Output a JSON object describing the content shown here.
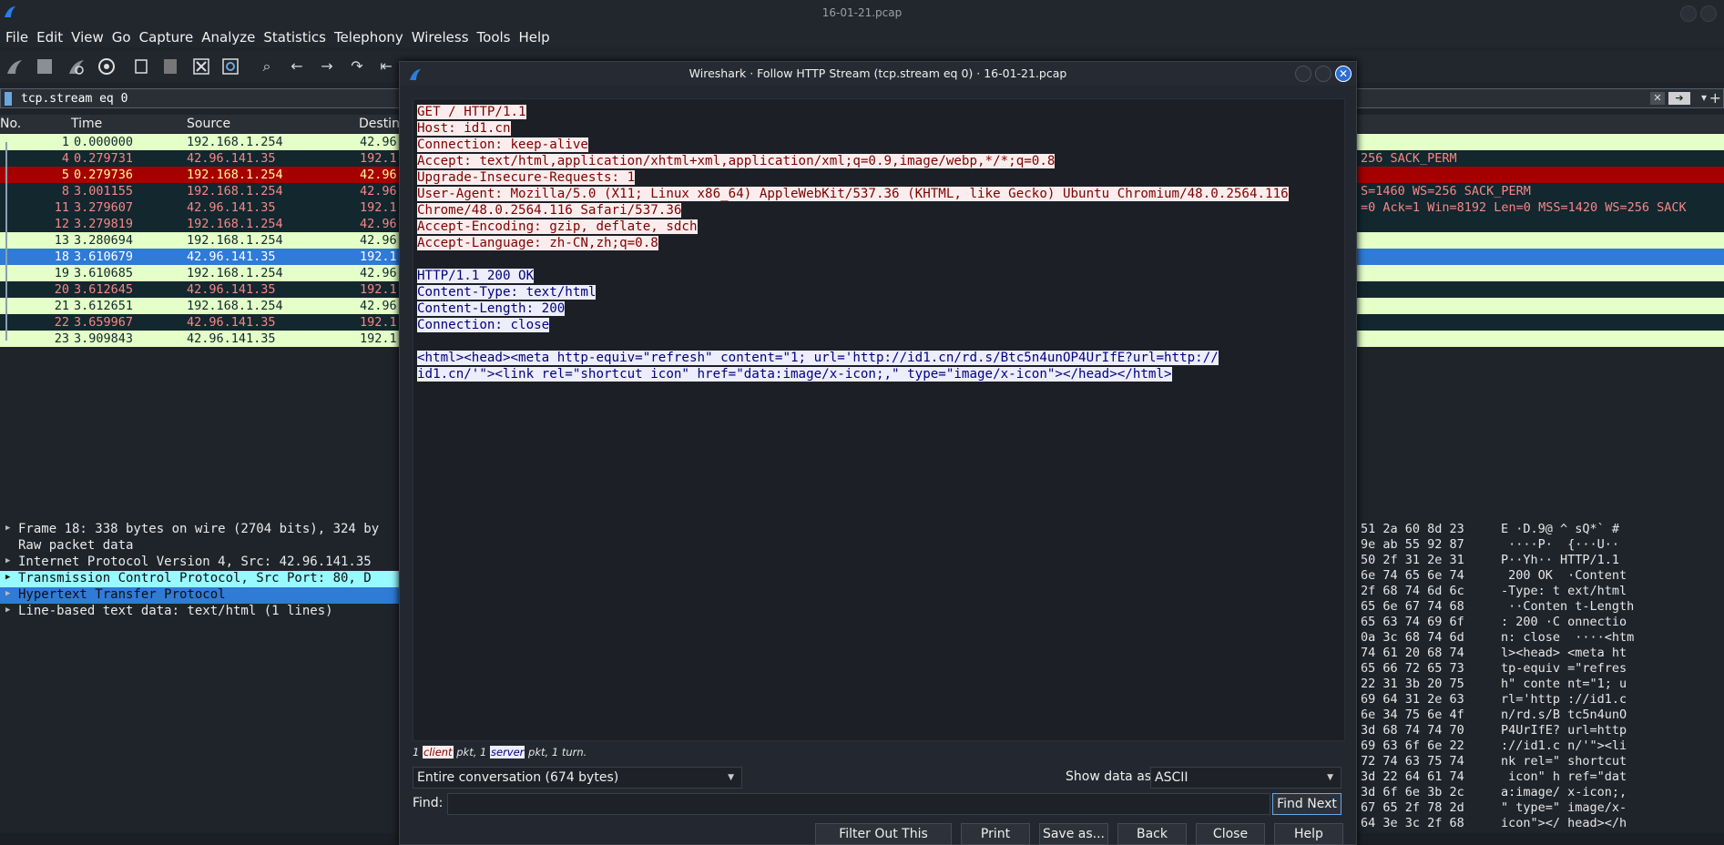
{
  "window": {
    "title": "16-01-21.pcap"
  },
  "menubar": [
    "File",
    "Edit",
    "View",
    "Go",
    "Capture",
    "Analyze",
    "Statistics",
    "Telephony",
    "Wireless",
    "Tools",
    "Help"
  ],
  "filter": {
    "value": "tcp.stream eq 0"
  },
  "packet_list": {
    "columns": {
      "no": "No.",
      "time": "Time",
      "source": "Source",
      "dest": "Destin"
    },
    "rows": [
      {
        "no": "1",
        "time": "0.000000",
        "src": "192.168.1.254",
        "dst": "42.96",
        "info": "",
        "style": "light"
      },
      {
        "no": "4",
        "time": "0.279731",
        "src": "42.96.141.35",
        "dst": "192.1",
        "info": "256 SACK_PERM",
        "style": "dark"
      },
      {
        "no": "5",
        "time": "0.279736",
        "src": "192.168.1.254",
        "dst": "42.96",
        "info": "",
        "style": "rst"
      },
      {
        "no": "8",
        "time": "3.001155",
        "src": "192.168.1.254",
        "dst": "42.96",
        "info": "S=1460 WS=256 SACK_PERM",
        "style": "dark"
      },
      {
        "no": "11",
        "time": "3.279607",
        "src": "42.96.141.35",
        "dst": "192.1",
        "info": "=0 Ack=1 Win=8192 Len=0 MSS=1420 WS=256 SACK",
        "style": "dark"
      },
      {
        "no": "12",
        "time": "3.279819",
        "src": "192.168.1.254",
        "dst": "42.96",
        "info": "",
        "style": "dark"
      },
      {
        "no": "13",
        "time": "3.280694",
        "src": "192.168.1.254",
        "dst": "42.96",
        "info": "",
        "style": "light"
      },
      {
        "no": "18",
        "time": "3.610679",
        "src": "42.96.141.35",
        "dst": "192.1",
        "info": "",
        "style": "sel"
      },
      {
        "no": "19",
        "time": "3.610685",
        "src": "192.168.1.254",
        "dst": "42.96",
        "info": "",
        "style": "light"
      },
      {
        "no": "20",
        "time": "3.612645",
        "src": "42.96.141.35",
        "dst": "192.1",
        "info": "",
        "style": "dark"
      },
      {
        "no": "21",
        "time": "3.612651",
        "src": "192.168.1.254",
        "dst": "42.96",
        "info": "",
        "style": "light"
      },
      {
        "no": "22",
        "time": "3.659967",
        "src": "42.96.141.35",
        "dst": "192.1",
        "info": "",
        "style": "dark"
      },
      {
        "no": "23",
        "time": "3.909843",
        "src": "42.96.141.35",
        "dst": "192.1",
        "info": "",
        "style": "light"
      }
    ]
  },
  "details": [
    {
      "text": "Frame 18: 338 bytes on wire (2704 bits), 324 by",
      "arrow": true,
      "style": ""
    },
    {
      "text": "Raw packet data",
      "arrow": false,
      "style": ""
    },
    {
      "text": "Internet Protocol Version 4, Src: 42.96.141.35",
      "arrow": true,
      "style": ""
    },
    {
      "text": "Transmission Control Protocol, Src Port: 80, D",
      "arrow": true,
      "style": "hl"
    },
    {
      "text": "Hypertext Transfer Protocol",
      "arrow": true,
      "style": "sel"
    },
    {
      "text": "Line-based text data: text/html (1 lines)",
      "arrow": true,
      "style": ""
    }
  ],
  "bytes": [
    {
      "hex": "51 2a 60 8d 23",
      "ascii": "E ·D.9@ ^ sQ*` #"
    },
    {
      "hex": "9e ab 55 92 87",
      "ascii": " ····P·  {···U··"
    },
    {
      "hex": "50 2f 31 2e 31",
      "ascii": "P··Yh·· HTTP/1.1"
    },
    {
      "hex": "6e 74 65 6e 74",
      "ascii": " 200 OK  ·Content"
    },
    {
      "hex": "2f 68 74 6d 6c",
      "ascii": "-Type: t ext/html"
    },
    {
      "hex": "65 6e 67 74 68",
      "ascii": " ··Conten t-Length"
    },
    {
      "hex": "65 63 74 69 6f",
      "ascii": ": 200 ·C onnectio"
    },
    {
      "hex": "0a 3c 68 74 6d",
      "ascii": "n: close  ····<htm"
    },
    {
      "hex": "74 61 20 68 74",
      "ascii": "l><head> <meta ht"
    },
    {
      "hex": "65 66 72 65 73",
      "ascii": "tp-equiv =\"refres"
    },
    {
      "hex": "22 31 3b 20 75",
      "ascii": "h\" conte nt=\"1; u"
    },
    {
      "hex": "69 64 31 2e 63",
      "ascii": "rl='http ://id1.c"
    },
    {
      "hex": "6e 34 75 6e 4f",
      "ascii": "n/rd.s/B tc5n4unO"
    },
    {
      "hex": "3d 68 74 74 70",
      "ascii": "P4UrIfE? url=http"
    },
    {
      "hex": "69 63 6f 6e 22",
      "ascii": "://id1.c n/'\"><li"
    },
    {
      "hex": "72 74 63 75 74",
      "ascii": "nk rel=\" shortcut"
    },
    {
      "hex": "3d 22 64 61 74",
      "ascii": " icon\" h ref=\"dat"
    },
    {
      "hex": "3d 6f 6e 3b 2c",
      "ascii": "a:image/ x-icon;,"
    },
    {
      "hex": "67 65 2f 78 2d",
      "ascii": "\" type=\" image/x-"
    },
    {
      "hex": "64 3e 3c 2f 68",
      "ascii": "icon\"></ head></h"
    }
  ],
  "dialog": {
    "title": "Wireshark · Follow HTTP Stream (tcp.stream eq 0) · 16-01-21.pcap",
    "stream_lines": [
      {
        "text": "GET / HTTP/1.1",
        "dir": "c"
      },
      {
        "text": "Host: id1.cn",
        "dir": "c"
      },
      {
        "text": "Connection: keep-alive",
        "dir": "c"
      },
      {
        "text": "Accept: text/html,application/xhtml+xml,application/xml;q=0.9,image/webp,*/*;q=0.8",
        "dir": "c"
      },
      {
        "text": "Upgrade-Insecure-Requests: 1",
        "dir": "c"
      },
      {
        "text": "User-Agent: Mozilla/5.0 (X11; Linux x86_64) AppleWebKit/537.36 (KHTML, like Gecko) Ubuntu Chromium/48.0.2564.116",
        "dir": "c"
      },
      {
        "text": "Chrome/48.0.2564.116 Safari/537.36",
        "dir": "c"
      },
      {
        "text": "Accept-Encoding: gzip, deflate, sdch",
        "dir": "c"
      },
      {
        "text": "Accept-Language: zh-CN,zh;q=0.8",
        "dir": "c"
      },
      {
        "text": "",
        "dir": ""
      },
      {
        "text": "HTTP/1.1 200 OK",
        "dir": "s"
      },
      {
        "text": "Content-Type: text/html",
        "dir": "s"
      },
      {
        "text": "Content-Length: 200",
        "dir": "s"
      },
      {
        "text": "Connection: close",
        "dir": "s"
      },
      {
        "text": "",
        "dir": ""
      },
      {
        "text": "<html><head><meta http-equiv=\"refresh\" content=\"1; url='http://id1.cn/rd.s/Btc5n4unOP4UrIfE?url=http://",
        "dir": "s"
      },
      {
        "text": "id1.cn/'\"><link rel=\"shortcut icon\" href=\"data:image/x-icon;,\" type=\"image/x-icon\"></head></html>",
        "dir": "s"
      }
    ],
    "turn_info": {
      "pre": "1 ",
      "client": "client",
      "mid": " pkt, 1 ",
      "server": "server",
      "post": " pkt, 1 turn."
    },
    "conversation": "Entire conversation (674 bytes)",
    "show_as_label": "Show data as",
    "show_as_value": "ASCII",
    "find_label": "Find:",
    "buttons": {
      "find_next": "Find Next",
      "filter_out": "Filter Out This Stream",
      "print": "Print",
      "save_as": "Save as...",
      "back": "Back",
      "close": "Close",
      "help": "Help"
    }
  }
}
